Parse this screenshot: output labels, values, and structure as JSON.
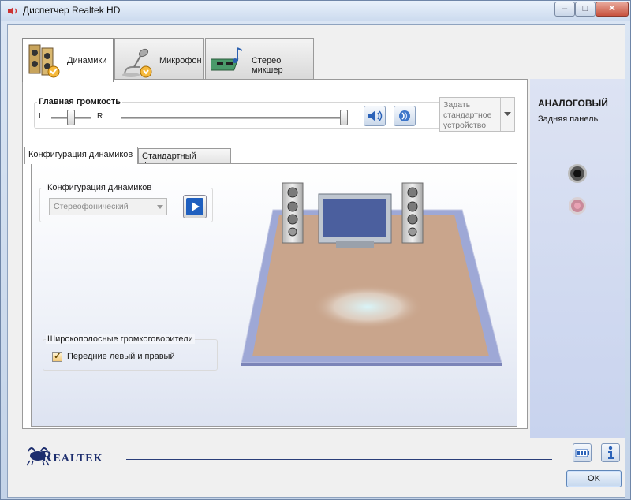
{
  "window": {
    "title": "Диспетчер Realtek HD",
    "controls": {
      "minimize": "–",
      "maximize": "□",
      "close": "✕"
    }
  },
  "tabs": [
    {
      "label": "Динамики",
      "icon": "speakers-icon",
      "active": true
    },
    {
      "label": "Микрофон",
      "icon": "microphone-icon",
      "active": false
    },
    {
      "label": "Стерео микшер",
      "icon": "stereo-mixer-icon",
      "active": false
    }
  ],
  "volume": {
    "label": "Главная громкость",
    "left": "L",
    "right": "R",
    "balance_level": 0.5,
    "volume_level": 1.0
  },
  "default_device": {
    "label": "Задать стандартное устройство"
  },
  "subtabs": [
    {
      "label": "Конфигурация динамиков",
      "active": true
    },
    {
      "label": "Стандартный формат",
      "active": false
    }
  ],
  "speaker_config": {
    "group_label": "Конфигурация динамиков",
    "selected": "Стереофонический"
  },
  "fullrange": {
    "group_label": "Широкополосные громкоговорители",
    "option_label": "Передние левый и правый",
    "checked": true
  },
  "right_panel": {
    "title": "АНАЛОГОВЫЙ",
    "subtitle": "Задняя панель",
    "jack_colors": [
      "#111111",
      "#e8a3b4"
    ]
  },
  "footer": {
    "brand": "Realtek",
    "ok_label": "OK"
  },
  "colors": {
    "accent": "#2a3e7a",
    "floor": "#c9a58c",
    "title_bar": "#dbe6f4"
  }
}
